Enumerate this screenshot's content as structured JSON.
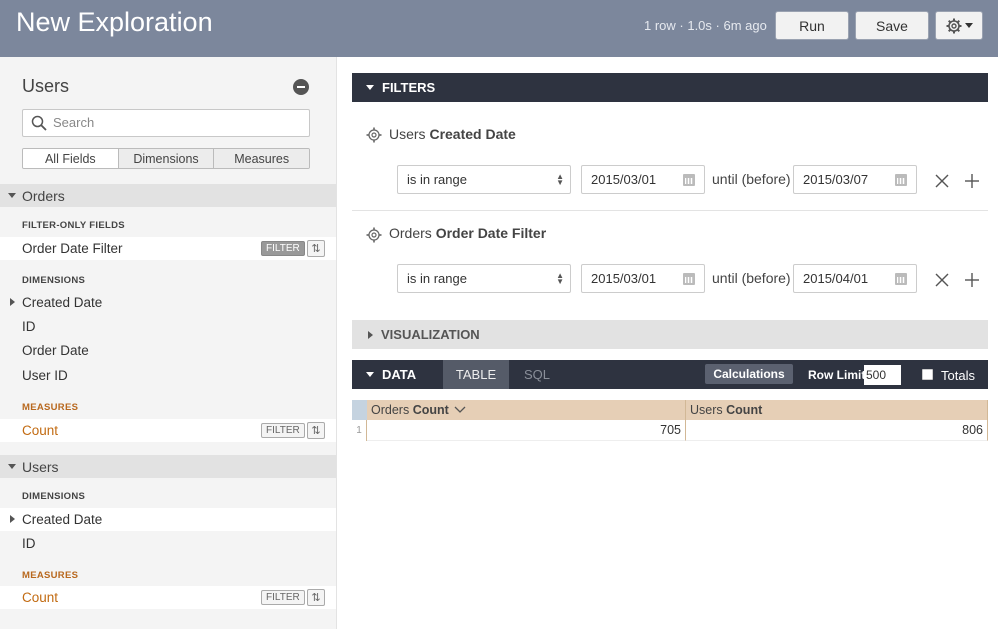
{
  "header": {
    "title": "New Exploration",
    "status": "1 row · 1.0s · 6m ago",
    "run_label": "Run",
    "save_label": "Save",
    "gear_icon": "gear-icon"
  },
  "sidebar": {
    "title": "Users",
    "search_placeholder": "Search",
    "tabs": [
      "All Fields",
      "Dimensions",
      "Measures"
    ],
    "active_tab": "All Fields",
    "groups": [
      {
        "name": "Orders",
        "filter_only_label": "FILTER-ONLY FIELDS",
        "filter_only_fields": [
          "Order Date Filter"
        ],
        "dimensions_label": "DIMENSIONS",
        "dimensions": [
          "Created Date",
          "ID",
          "Order Date",
          "User ID"
        ],
        "measures_label": "MEASURES",
        "measures": [
          "Count"
        ]
      },
      {
        "name": "Users",
        "dimensions_label": "DIMENSIONS",
        "dimensions": [
          "Created Date",
          "ID"
        ],
        "measures_label": "MEASURES",
        "measures": [
          "Count"
        ]
      }
    ],
    "filter_badge": "FILTER"
  },
  "filters": {
    "section_label": "FILTERS",
    "items": [
      {
        "view": "Users",
        "field": "Created Date",
        "operator": "is in range",
        "from": "2015/03/01",
        "until_label": "until (before)",
        "to": "2015/03/07"
      },
      {
        "view": "Orders",
        "field": "Order Date Filter",
        "operator": "is in range",
        "from": "2015/03/01",
        "until_label": "until (before)",
        "to": "2015/04/01"
      }
    ]
  },
  "visualization": {
    "section_label": "VISUALIZATION"
  },
  "data": {
    "section_label": "DATA",
    "tabs": [
      "TABLE",
      "SQL"
    ],
    "calculations_label": "Calculations",
    "row_limit_label": "Row Limit",
    "row_limit": "500",
    "totals_label": "Totals",
    "columns": [
      {
        "view": "Orders",
        "field": "Count"
      },
      {
        "view": "Users",
        "field": "Count"
      }
    ],
    "rows": [
      {
        "index": "1",
        "values": [
          "705",
          "806"
        ]
      }
    ]
  }
}
